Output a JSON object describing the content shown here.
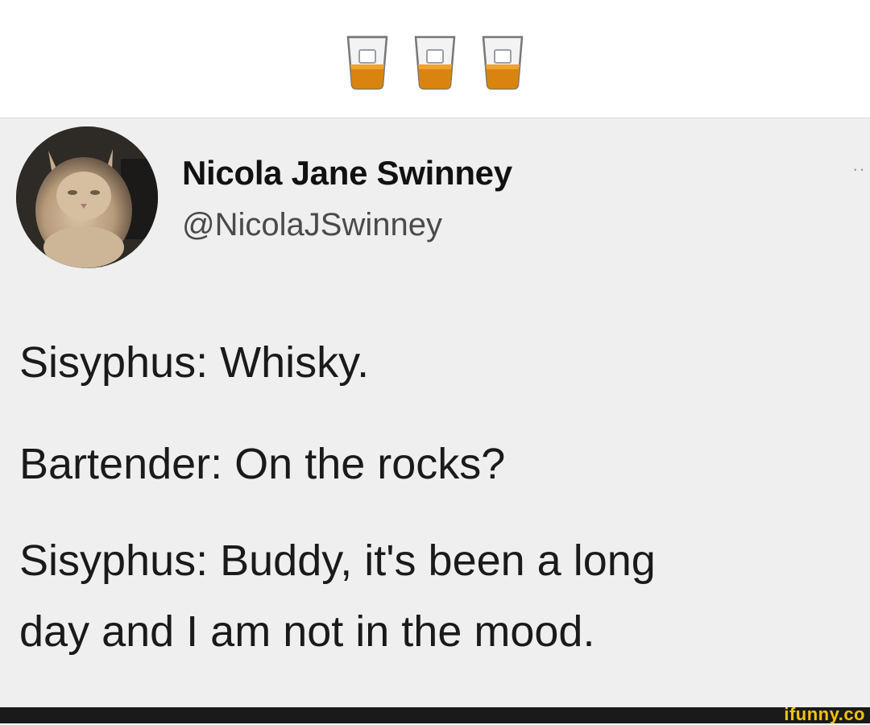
{
  "caption": {
    "emoji": [
      "tumbler-glass-icon",
      "tumbler-glass-icon",
      "tumbler-glass-icon"
    ],
    "emoji_color": "#d8840e"
  },
  "tweet": {
    "display_name": "Nicola Jane Swinney",
    "handle": "@NicolaJSwinney",
    "more_glyph": "··",
    "avatar": "cat-avatar",
    "lines": [
      "Sisyphus: Whisky.",
      "Bartender: On the rocks?",
      "Sisyphus: Buddy, it's been a long",
      "day and I am not in the mood."
    ]
  },
  "footer": {
    "watermark": "ifunny.co"
  }
}
